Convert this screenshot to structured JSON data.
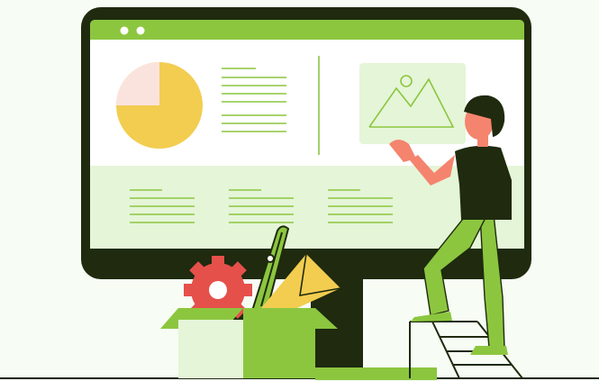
{
  "illustration": {
    "subject": "person-presenting-dashboard-on-monitor",
    "icons": [
      "window-dots-icon",
      "pie-chart-icon",
      "image-placeholder-icon",
      "gear-icon",
      "envelope-icon",
      "pen-icon",
      "box-icon",
      "ladder-icon"
    ]
  },
  "colors": {
    "background": "#f7fcf4",
    "monitor_frame": "#1f2a0f",
    "accent_green": "#8cc63f",
    "light_green": "#e5f5d8",
    "pie_yellow": "#f2cd50",
    "pie_pink": "#fbe3dd",
    "gear_red": "#e5504a",
    "skin": "#f4846d",
    "hair": "#1f2a0f"
  }
}
